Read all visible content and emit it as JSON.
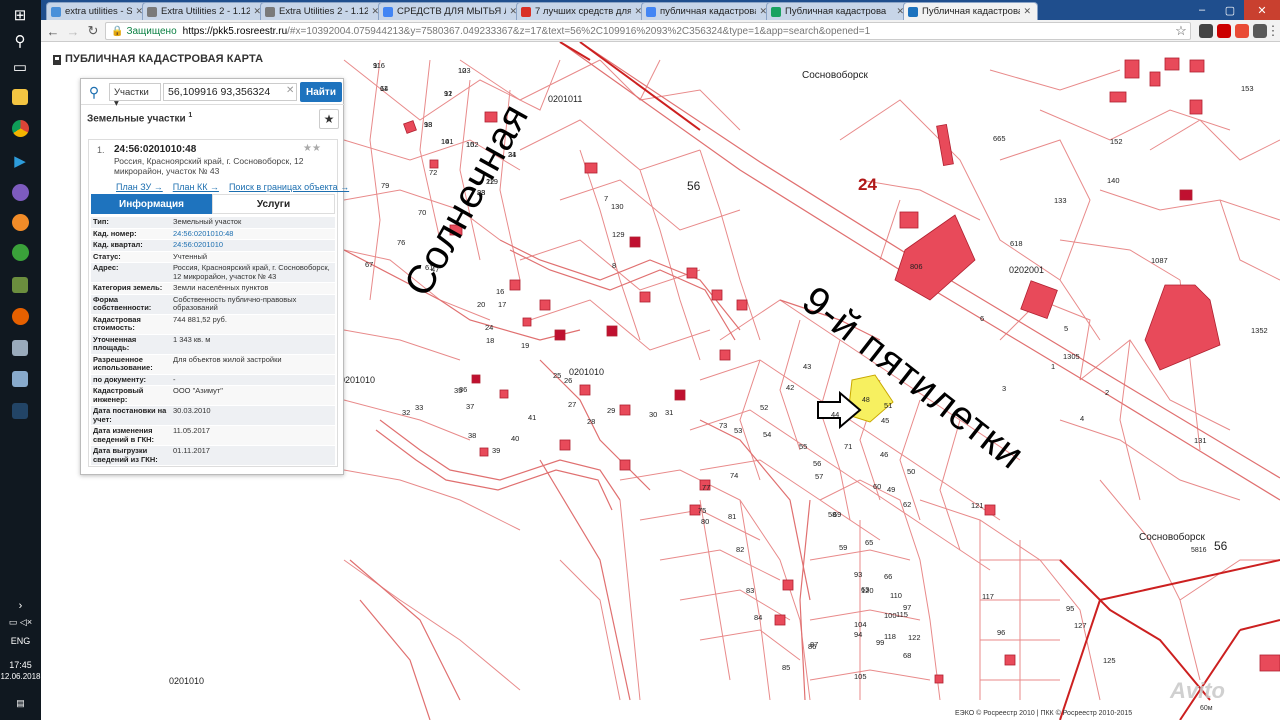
{
  "browser": {
    "tabs": [
      {
        "title": "extra utilities - Search -",
        "fav": "#4a90d9",
        "active": false
      },
      {
        "title": "Extra Utilities 2 - 1.12 -",
        "fav": "#7a7a7a",
        "active": false
      },
      {
        "title": "Extra Utilities 2 - 1.12 -",
        "fav": "#7a7a7a",
        "active": false
      },
      {
        "title": "СРЕДСТВ ДЛЯ МЫТЬЯ Л",
        "fav": "#4285f4",
        "active": false
      },
      {
        "title": "7 лучших средств для",
        "fav": "#d93025",
        "active": false
      },
      {
        "title": "публичная кадастровая",
        "fav": "#4285f4",
        "active": false
      },
      {
        "title": "Публичная кадастрова",
        "fav": "#1aa260",
        "active": false
      },
      {
        "title": "Публичная кадастрова",
        "fav": "#1e73be",
        "active": true
      }
    ],
    "secure_label": "Защищено",
    "url_host": "https://pkk5.rosreestr.ru",
    "url_path": "/#x=10392004.075944213&y=7580367.049233367&z=17&text=56%2C109916%2093%2C356324&type=1&app=search&opened=1"
  },
  "taskbar": {
    "language": "ENG",
    "time": "17:45",
    "date": "12.06.2018"
  },
  "pkk": {
    "app_title": "ПУБЛИЧНАЯ КАДАСТРОВАЯ КАРТА",
    "search": {
      "type_label": "Участки",
      "query": "56,109916 93,356324",
      "button": "Найти"
    },
    "section_title": "Земельные участки",
    "section_count": "1",
    "card": {
      "num": "1.",
      "cad_number": "24:56:0201010:48",
      "address": "Россия, Красноярский край, г. Сосновоборск, 12 микрорайон, участок № 43",
      "links": [
        "План ЗУ →",
        "План КК →",
        "Поиск в границах объекта →"
      ],
      "tab_info": "Информация",
      "tab_services": "Услуги",
      "attributes": [
        {
          "k": "Тип:",
          "v": "Земельный участок"
        },
        {
          "k": "Кад. номер:",
          "v": "24:56:0201010:48"
        },
        {
          "k": "Кад. квартал:",
          "v": "24:56:0201010"
        },
        {
          "k": "Статус:",
          "v": "Учтенный"
        },
        {
          "k": "Адрес:",
          "v": "Россия, Красноярский край, г. Сосновоборск, 12 микрорайон, участок № 43"
        },
        {
          "k": "Категория земель:",
          "v": "Земли населённых пунктов"
        },
        {
          "k": "Форма собственности:",
          "v": "Собственность публично-правовых образований"
        },
        {
          "k": "Кадастровая стоимость:",
          "v": "744 881,52 руб."
        },
        {
          "k": "Уточненная площадь:",
          "v": "1 343 кв. м"
        },
        {
          "k": "Разрешенное использование:",
          "v": "Для объектов жилой застройки"
        },
        {
          "k": "по документу:",
          "v": "-"
        },
        {
          "k": "Кадастровый инженер:",
          "v": "ООО \"Азимут\""
        },
        {
          "k": "Дата постановки на учет:",
          "v": "30.03.2010"
        },
        {
          "k": "Дата изменения сведений в ГКН:",
          "v": "11.05.2017"
        },
        {
          "k": "Дата выгрузки сведений из ГКН:",
          "v": "01.11.2017"
        }
      ]
    }
  },
  "map": {
    "streets": {
      "solnechnaya": "Солнечная",
      "pyatiletki": "9-й пятилетки"
    },
    "locality": "Сосновоборск",
    "blocks": {
      "b24": "24",
      "b56": "56",
      "b56b": "56"
    },
    "quarters": [
      "0201011",
      "0201010",
      "0201010",
      "0202001",
      "0201010",
      "5816"
    ],
    "selected_parcel": "48",
    "parcel_numbers": [
      "116",
      "123",
      "64",
      "91",
      "98",
      "101",
      "102",
      "34",
      "119",
      "88",
      "79",
      "72",
      "70",
      "76",
      "67",
      "61",
      "47",
      "24",
      "20",
      "17",
      "16",
      "18",
      "19",
      "25",
      "26",
      "27",
      "28",
      "29",
      "30",
      "31",
      "32",
      "33",
      "35",
      "36",
      "37",
      "38",
      "39",
      "40",
      "41",
      "42",
      "43",
      "44",
      "45",
      "46",
      "49",
      "50",
      "51",
      "52",
      "53",
      "54",
      "55",
      "56",
      "57",
      "58",
      "59",
      "60",
      "62",
      "63",
      "65",
      "66",
      "68",
      "69",
      "71",
      "73",
      "74",
      "75",
      "77",
      "80",
      "81",
      "82",
      "83",
      "84",
      "85",
      "86",
      "87",
      "93",
      "94",
      "95",
      "96",
      "97",
      "99",
      "100",
      "104",
      "105",
      "110",
      "115",
      "117",
      "118",
      "120",
      "121",
      "122",
      "125",
      "127",
      "129",
      "130",
      "131",
      "133",
      "140",
      "152",
      "153",
      "618",
      "665",
      "806",
      "1087",
      "1305",
      "1352",
      "1",
      "2",
      "3",
      "4",
      "5",
      "6",
      "7",
      "8",
      "9",
      "10",
      "11",
      "12",
      "13",
      "14",
      "15",
      "21",
      "22",
      "23"
    ],
    "attribution": "ЕЭКО © Росреестр 2010 | ПКК © Росреестр 2010-2015",
    "scale": "60м",
    "watermark": "Avito"
  },
  "colors": {
    "parcel_line": "#e88a8a",
    "parcel_fill": "#e84a5a",
    "quarter_line": "#cc2020",
    "selected_fill": "#f7f060",
    "accent": "#1e73be"
  }
}
